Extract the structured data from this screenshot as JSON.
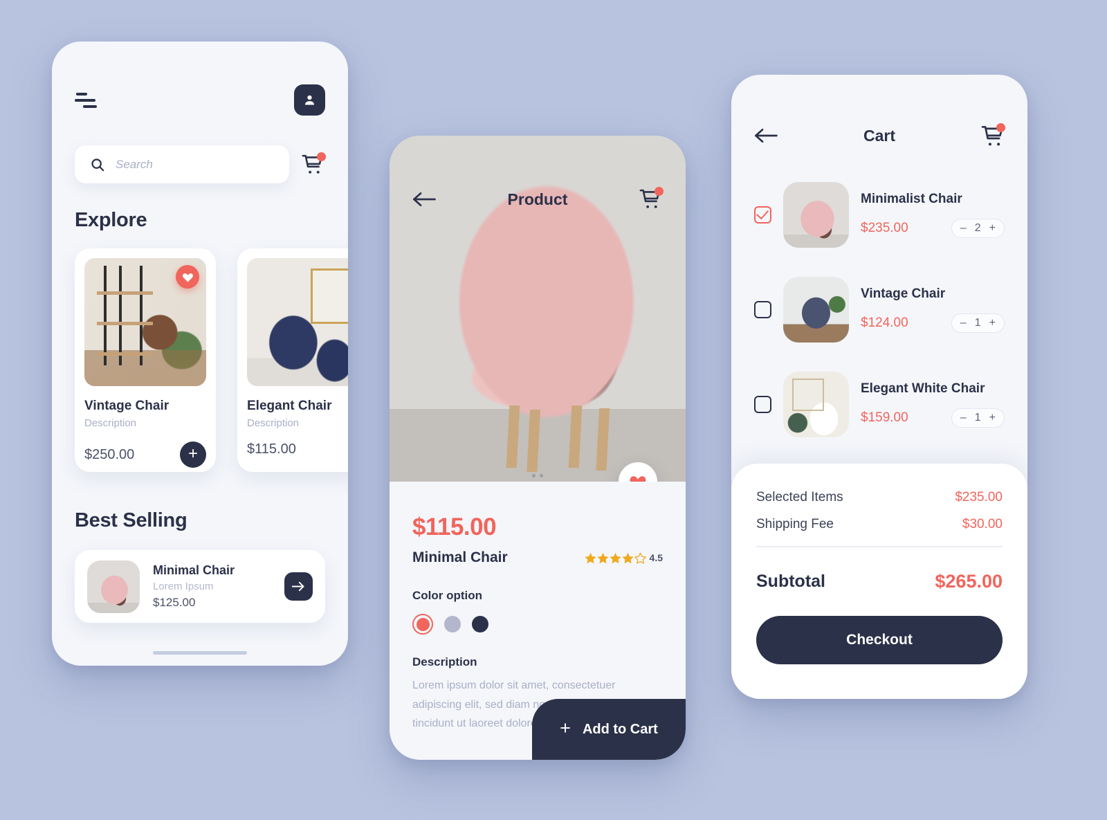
{
  "home": {
    "menu_icon": "hamburger-icon",
    "avatar_icon": "user-icon",
    "search": {
      "placeholder": "Search",
      "value": "",
      "icon": "search-icon"
    },
    "cart_icon": "cart-icon",
    "explore_title": "Explore",
    "explore_cards": [
      {
        "name": "Vintage Chair",
        "description": "Description",
        "price": "$250.00",
        "favorite": true,
        "add_label": "+",
        "image": "vintage-chair-room-photo"
      },
      {
        "name": "Elegant Chair",
        "description": "Description",
        "price": "$115.00",
        "favorite": false,
        "image": "elegant-blue-chair-photo"
      }
    ],
    "best_selling_title": "Best Selling",
    "best_selling": {
      "name": "Minimal Chair",
      "subtitle": "Lorem Ipsum",
      "price": "$125.00",
      "arrow_icon": "arrow-right-icon",
      "image": "minimal-pink-chair-photo"
    }
  },
  "product": {
    "back_icon": "arrow-left-icon",
    "title": "Product",
    "cart_icon": "cart-icon",
    "favorite_icon": "heart-icon",
    "hero_image": "pink-minimal-chair-photo",
    "price": "$115.00",
    "name": "Minimal Chair",
    "rating": {
      "value": "4.5",
      "stars_filled": 4,
      "stars_total": 5
    },
    "color_option_label": "Color option",
    "colors": [
      {
        "name": "coral",
        "hex": "#f0655c",
        "selected": true
      },
      {
        "name": "lavender-grey",
        "hex": "#b3b6cd",
        "selected": false
      },
      {
        "name": "dark-navy",
        "hex": "#2b3148",
        "selected": false
      }
    ],
    "description_label": "Description",
    "description_text": "Lorem ipsum dolor sit amet, consectetuer adipiscing elit, sed diam nonummy nibh euismod tincidunt ut laoreet dolore magna.",
    "add_to_cart_label": "Add to Cart",
    "add_to_cart_icon": "plus-icon"
  },
  "cart": {
    "back_icon": "arrow-left-icon",
    "title": "Cart",
    "cart_icon": "cart-icon",
    "items": [
      {
        "name": "Minimalist Chair",
        "price": "$235.00",
        "qty": "2",
        "selected": true,
        "image": "minimal-pink-chair-photo",
        "minus": "–",
        "plus": "+"
      },
      {
        "name": "Vintage Chair",
        "price": "$124.00",
        "qty": "1",
        "selected": false,
        "image": "blue-armchair-photo",
        "minus": "–",
        "plus": "+"
      },
      {
        "name": "Elegant White Chair",
        "price": "$159.00",
        "qty": "1",
        "selected": false,
        "image": "white-chair-photo",
        "minus": "–",
        "plus": "+"
      }
    ],
    "summary": {
      "selected_items_label": "Selected Items",
      "selected_items_value": "$235.00",
      "shipping_label": "Shipping Fee",
      "shipping_value": "$30.00",
      "subtotal_label": "Subtotal",
      "subtotal_value": "$265.00",
      "checkout_label": "Checkout"
    }
  },
  "theme": {
    "background": "#b8c3df",
    "surface": "#f4f6fa",
    "card": "#ffffff",
    "accent": "#f0655c",
    "dark": "#2b3148",
    "muted": "#a9afc6",
    "star": "#f0a91e"
  }
}
